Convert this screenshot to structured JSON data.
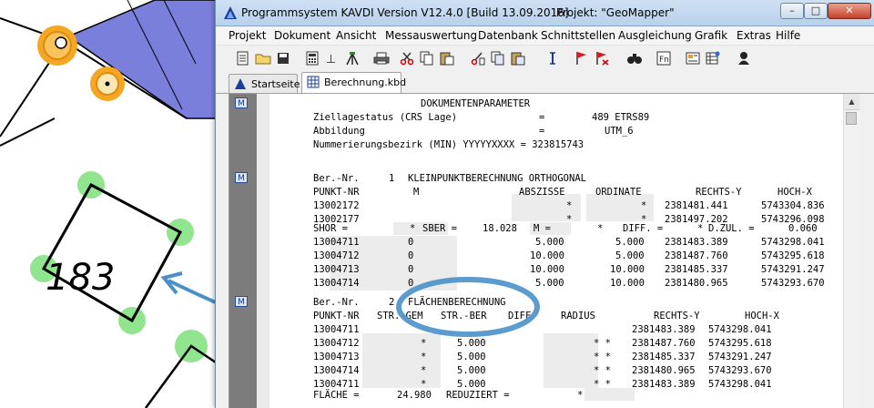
{
  "map": {
    "parcel_label": "183"
  },
  "window": {
    "title": "Programmsystem KAVDI Version V12.4.0 [Build 13.09.2016]",
    "project": "Projekt: \"GeoMapper\"",
    "controls": {
      "minimize": "–",
      "maximize": "□",
      "close": "✕"
    }
  },
  "menu": [
    "Projekt",
    "Dokument",
    "Ansicht",
    "Messauswertung",
    "Datenbank",
    "Schnittstellen",
    "Ausgleichung",
    "Grafik",
    "Extras",
    "Hilfe"
  ],
  "toolbar_icons": [
    "new-document-icon",
    "open-folder-icon",
    "save-icon",
    "calculator-icon",
    "survey-point-icon",
    "tripod-icon",
    "printer-icon",
    "scissors-icon",
    "copy-icon",
    "paste-icon",
    "cut-list-icon",
    "copy-list-icon",
    "paste-list-icon",
    "text-cursor-icon",
    "flag-icon",
    "flag-delete-icon",
    "binoculars-icon",
    "function-icon",
    "report-icon",
    "table-settings-icon",
    "help-person-icon"
  ],
  "tabs": [
    {
      "label": "Startseite",
      "active": false
    },
    {
      "label": "Berechnung.kbd",
      "active": true
    }
  ],
  "doc": {
    "params": {
      "header": "DOKUMENTENPARAMETER",
      "line1_label": "Ziellagestatus (CRS Lage)",
      "line1_eq": "=",
      "line1_value": "489 ETRS89",
      "line2_label": "Abbildung",
      "line2_eq": "=",
      "line2_value": "UTM_6",
      "line3": "Nummerierungsbezirk (MIN) YYYYYXXXX = 323815743"
    },
    "section1": {
      "ber_nr_label": "Ber.-Nr.",
      "ber_nr": "1",
      "title": "KLEINPUNKTBERECHNUNG ORTHOGONAL",
      "headers": {
        "punkt": "PUNKT-NR",
        "m": "M",
        "abszisse": "ABSZISSE",
        "ordinate": "ORDINATE",
        "rechts": "RECHTS-Y",
        "hoch": "HOCH-X"
      },
      "rows_top": [
        {
          "punkt": "13002172",
          "abszisse": "*",
          "ordinate": "*",
          "rechts": "2381481.441",
          "hoch": "5743304.836"
        },
        {
          "punkt": "13002177",
          "abszisse": "*",
          "ordinate": "*",
          "rechts": "2381497.202",
          "hoch": "5743296.098"
        }
      ],
      "summary": {
        "shor_label": "SHOR =",
        "shor_star": "*",
        "sber_label": "SBER =",
        "sber_value": "18.028",
        "m_label": "M =",
        "m_star": "*",
        "diff_label": "DIFF. =",
        "diff_star": "*",
        "dzul_label": "D.ZUL. =",
        "dzul_value": "0.060"
      },
      "rows": [
        {
          "punkt": "13004711",
          "m": "0",
          "abszisse": "5.000",
          "ordinate": "5.000",
          "rechts": "2381483.389",
          "hoch": "5743298.041"
        },
        {
          "punkt": "13004712",
          "m": "0",
          "abszisse": "10.000",
          "ordinate": "5.000",
          "rechts": "2381487.760",
          "hoch": "5743295.618"
        },
        {
          "punkt": "13004713",
          "m": "0",
          "abszisse": "10.000",
          "ordinate": "10.000",
          "rechts": "2381485.337",
          "hoch": "5743291.247"
        },
        {
          "punkt": "13004714",
          "m": "0",
          "abszisse": "5.000",
          "ordinate": "10.000",
          "rechts": "2381480.965",
          "hoch": "5743293.670"
        }
      ]
    },
    "section2": {
      "ber_nr_label": "Ber.-Nr.",
      "ber_nr": "2",
      "title": "FLÄCHENBERECHNUNG",
      "headers": {
        "punkt": "PUNKT-NR",
        "strgem": "STR.-GEM",
        "strber": "STR.-BER",
        "diff": "DIFF",
        "radius": "RADIUS",
        "rechts": "RECHTS-Y",
        "hoch": "HOCH-X"
      },
      "rows": [
        {
          "punkt": "13004711",
          "strgem": "",
          "strber": "",
          "rechts": "2381483.389",
          "hoch": "5743298.041"
        },
        {
          "punkt": "13004712",
          "strgem": "*",
          "strber": "5.000",
          "stars": "* *",
          "rechts": "2381487.760",
          "hoch": "5743295.618"
        },
        {
          "punkt": "13004713",
          "strgem": "*",
          "strber": "5.000",
          "stars": "* *",
          "rechts": "2381485.337",
          "hoch": "5743291.247"
        },
        {
          "punkt": "13004714",
          "strgem": "*",
          "strber": "5.000",
          "stars": "* *",
          "rechts": "2381480.965",
          "hoch": "5743293.670"
        },
        {
          "punkt": "13004711",
          "strgem": "*",
          "strber": "5.000",
          "stars": "* *",
          "rechts": "2381483.389",
          "hoch": "5743298.041"
        }
      ],
      "flaeche_label": "FLÄCHE =",
      "flaeche_value": "24.980",
      "reduziert_label": "REDUZIERT =",
      "reduziert_star": "*"
    },
    "marker_label": "M"
  },
  "colors": {
    "point_number": "#2233bb",
    "coordinate": "#cc1010",
    "annotation": "#4a90c8",
    "map_point": "#7ee07a",
    "map_marker": "#f5a623",
    "map_building": "#7b7fdc"
  }
}
